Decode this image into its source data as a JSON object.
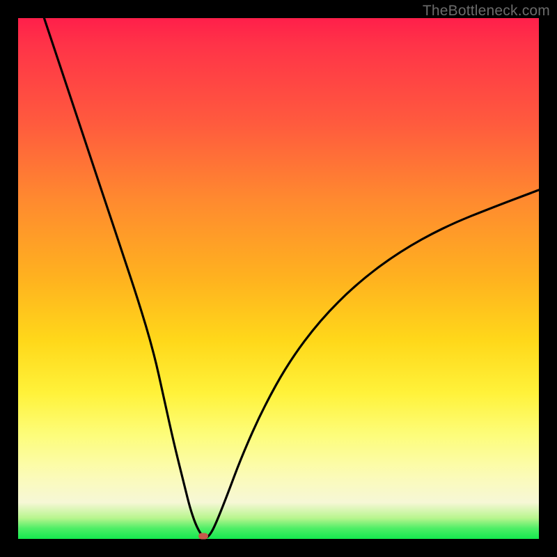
{
  "watermark": "TheBottleneck.com",
  "chart_data": {
    "type": "line",
    "title": "",
    "xlabel": "",
    "ylabel": "",
    "xlim": [
      0,
      100
    ],
    "ylim": [
      0,
      100
    ],
    "series": [
      {
        "name": "bottleneck-curve",
        "x": [
          5,
          8,
          11,
          14,
          17,
          20,
          23,
          26,
          28,
          30,
          32,
          33,
          34,
          35,
          36,
          37,
          38,
          40,
          43,
          47,
          52,
          58,
          65,
          73,
          82,
          92,
          100
        ],
        "y": [
          100,
          91,
          82,
          73,
          64,
          55,
          46,
          36,
          27,
          18,
          10,
          6,
          3,
          1,
          0,
          1,
          3,
          8,
          16,
          25,
          34,
          42,
          49,
          55,
          60,
          64,
          67
        ]
      }
    ],
    "marker": {
      "x": 35.5,
      "y": 0.6
    },
    "gradient_stops": [
      {
        "pos": 0,
        "color": "#ff1f4a"
      },
      {
        "pos": 50,
        "color": "#ffb21f"
      },
      {
        "pos": 80,
        "color": "#fdfd7a"
      },
      {
        "pos": 100,
        "color": "#14e94e"
      }
    ]
  }
}
